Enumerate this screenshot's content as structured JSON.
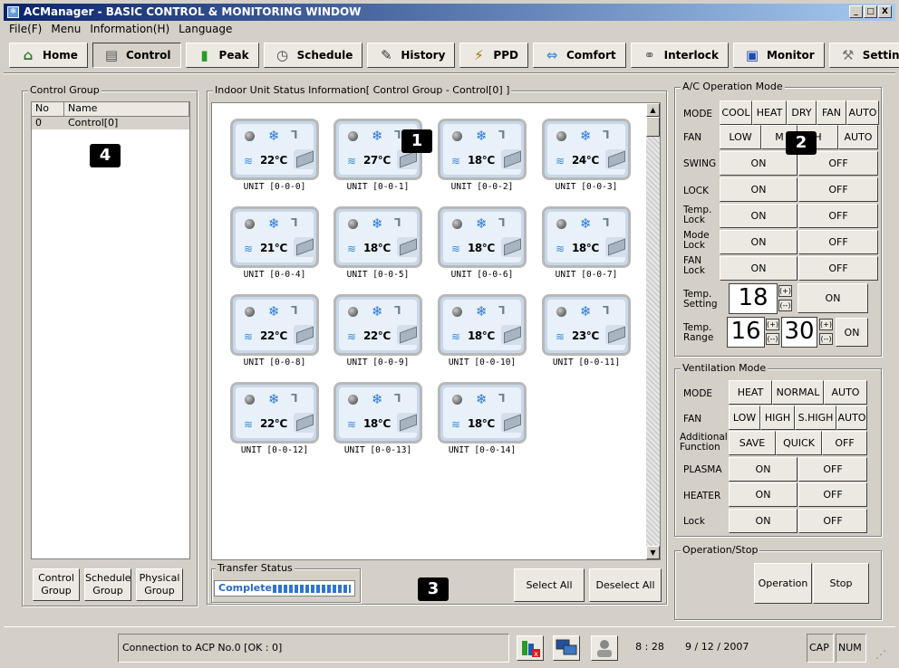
{
  "window": {
    "title": "ACManager - BASIC CONTROL & MONITORING WINDOW",
    "minimize": "_",
    "maximize": "□",
    "close": "X"
  },
  "menu": [
    "File(F)",
    "Menu",
    "Information(H)",
    "Language"
  ],
  "toolbar": [
    {
      "label": "Home",
      "icon": "home-icon",
      "glyph": "⌂",
      "color": "#2a7a2a"
    },
    {
      "label": "Control",
      "icon": "control-icon",
      "glyph": "▤",
      "color": "#555"
    },
    {
      "label": "Peak",
      "icon": "peak-chart-icon",
      "glyph": "▮",
      "color": "#2a9a2a"
    },
    {
      "label": "Schedule",
      "icon": "clock-icon",
      "glyph": "◷",
      "color": "#444"
    },
    {
      "label": "History",
      "icon": "history-icon",
      "glyph": "✎",
      "color": "#333"
    },
    {
      "label": "PPD",
      "icon": "ppd-icon",
      "glyph": "⚡",
      "color": "#a07000"
    },
    {
      "label": "Comfort",
      "icon": "comfort-icon",
      "glyph": "⇔",
      "color": "#4a90d0"
    },
    {
      "label": "Interlock",
      "icon": "interlock-icon",
      "glyph": "⚭",
      "color": "#666"
    },
    {
      "label": "Monitor",
      "icon": "monitor-icon",
      "glyph": "▣",
      "color": "#1a4ab0"
    },
    {
      "label": "Setting",
      "icon": "setting-icon",
      "glyph": "⚒",
      "color": "#777"
    }
  ],
  "control_group": {
    "title": "Control Group",
    "col_no": "No",
    "col_name": "Name",
    "rows": [
      {
        "no": "0",
        "name": "Control[0]"
      }
    ],
    "buttons": [
      "Control\nGroup",
      "Schedule\nGroup",
      "Physical\nGroup"
    ]
  },
  "unit_status": {
    "title": "Indoor Unit Status Information[ Control Group - Control[0] ]",
    "units": [
      {
        "label": "UNIT [0-0-0]",
        "temp": "22℃"
      },
      {
        "label": "UNIT [0-0-1]",
        "temp": "27℃"
      },
      {
        "label": "UNIT [0-0-2]",
        "temp": "18℃"
      },
      {
        "label": "UNIT [0-0-3]",
        "temp": "24℃"
      },
      {
        "label": "UNIT [0-0-4]",
        "temp": "21℃"
      },
      {
        "label": "UNIT [0-0-5]",
        "temp": "18℃"
      },
      {
        "label": "UNIT [0-0-6]",
        "temp": "18℃"
      },
      {
        "label": "UNIT [0-0-7]",
        "temp": "18℃"
      },
      {
        "label": "UNIT [0-0-8]",
        "temp": "22℃"
      },
      {
        "label": "UNIT [0-0-9]",
        "temp": "22℃"
      },
      {
        "label": "UNIT [0-0-10]",
        "temp": "18℃"
      },
      {
        "label": "UNIT [0-0-11]",
        "temp": "23℃"
      },
      {
        "label": "UNIT [0-0-12]",
        "temp": "22℃"
      },
      {
        "label": "UNIT [0-0-13]",
        "temp": "18℃"
      },
      {
        "label": "UNIT [0-0-14]",
        "temp": "18℃"
      }
    ]
  },
  "transfer": {
    "title": "Transfer Status",
    "status": "Complete",
    "progress": 1.0
  },
  "select_all": "Select All",
  "deselect_all": "Deselect All",
  "ac_mode": {
    "title": "A/C Operation Mode",
    "mode_label": "MODE",
    "modes": [
      "COOL",
      "HEAT",
      "DRY",
      "FAN",
      "AUTO"
    ],
    "fan_label": "FAN",
    "fans": [
      "LOW",
      "M",
      "H",
      "AUTO"
    ],
    "swing_label": "SWING",
    "lock_label": "LOCK",
    "temp_lock_label": "Temp.\nLock",
    "mode_lock_label": "Mode\nLock",
    "fan_lock_label": "FAN\nLock",
    "on": "ON",
    "off": "OFF",
    "temp_setting_label": "Temp.\nSetting",
    "temp_setting": "18",
    "temp_range_label": "Temp.\nRange",
    "range_low": "16",
    "range_high": "30",
    "plus": "(+)",
    "minus": "(--)"
  },
  "ventilation": {
    "title": "Ventilation Mode",
    "mode_label": "MODE",
    "modes": [
      "HEAT",
      "NORMAL",
      "AUTO"
    ],
    "fan_label": "FAN",
    "fans": [
      "LOW",
      "HIGH",
      "S.HIGH",
      "AUTO"
    ],
    "additional_label": "Additional\nFunction",
    "additional": [
      "SAVE",
      "QUICK",
      "OFF"
    ],
    "plasma_label": "PLASMA",
    "heater_label": "HEATER",
    "lock_label": "Lock",
    "on": "ON",
    "off": "OFF"
  },
  "operation": {
    "title": "Operation/Stop",
    "operation": "Operation",
    "stop": "Stop"
  },
  "status": {
    "connection": "Connection to ACP No.0 [OK : 0]",
    "time": "8 : 28",
    "date": "9 / 12 / 2007",
    "cap": "CAP",
    "num": "NUM"
  },
  "badges": [
    "1",
    "2",
    "3",
    "4"
  ]
}
